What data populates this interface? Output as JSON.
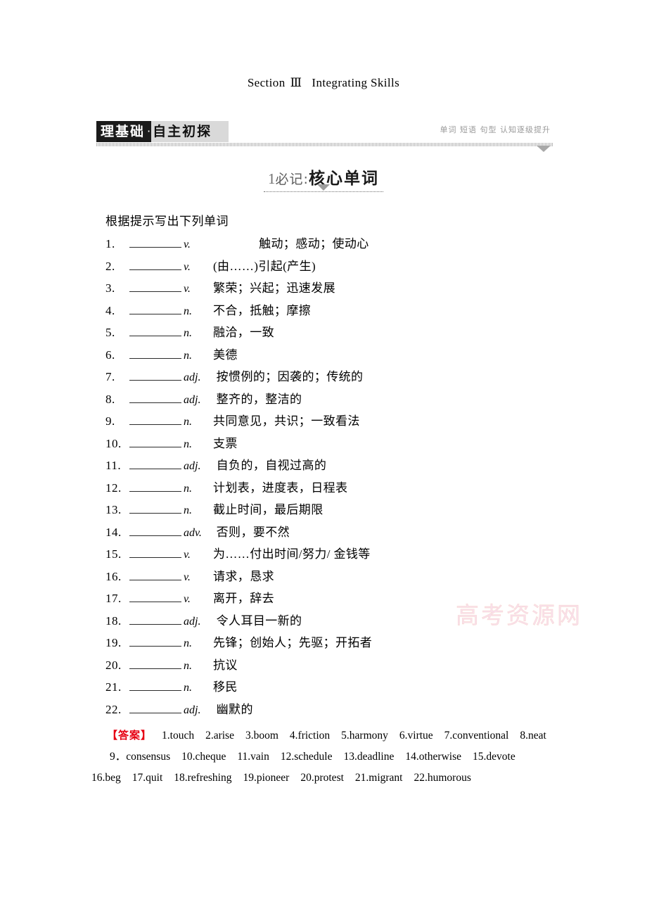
{
  "running_head": {
    "section_word": "Section",
    "section_number": "Ⅲ",
    "section_title": "Integrating Skills"
  },
  "banner": {
    "tag_dark": "理基础",
    "tag_dot": "·",
    "tag_light": "自主初探",
    "subtitle": "单词 短语 句型 认知逐级提升"
  },
  "part_heading": {
    "number": "1",
    "middle": "必记:",
    "main": "核心单词"
  },
  "instruction": "根据提示写出下列单词",
  "words": [
    {
      "num": "1.",
      "pos": "v.",
      "def": "              触动；感动；使动心"
    },
    {
      "num": "2.",
      "pos": "v.",
      "def": "(由……)引起(产生)"
    },
    {
      "num": "3.",
      "pos": "v.",
      "def": "繁荣；兴起；迅速发展"
    },
    {
      "num": "4.",
      "pos": "n.",
      "def": "不合，抵触；摩擦"
    },
    {
      "num": "5.",
      "pos": "n.",
      "def": "融洽，一致"
    },
    {
      "num": "6.",
      "pos": "n.",
      "def": "美德"
    },
    {
      "num": "7.",
      "pos": "adj.",
      "def": " 按惯例的；因袭的；传统的"
    },
    {
      "num": "8.",
      "pos": "adj.",
      "def": " 整齐的，整洁的"
    },
    {
      "num": "9.",
      "pos": "n.",
      "def": "共同意见，共识；一致看法"
    },
    {
      "num": "10.",
      "pos": "n.",
      "def": "支票"
    },
    {
      "num": "11.",
      "pos": "adj.",
      "def": " 自负的，自视过高的"
    },
    {
      "num": "12.",
      "pos": "n.",
      "def": "计划表，进度表，日程表"
    },
    {
      "num": "13.",
      "pos": "n.",
      "def": "截止时间，最后期限"
    },
    {
      "num": "14.",
      "pos": "adv.",
      "def": " 否则，要不然"
    },
    {
      "num": "15.",
      "pos": "v.",
      "def": "为……付出时间/努力/ 金钱等"
    },
    {
      "num": "16.",
      "pos": "v.",
      "def": "请求，恳求"
    },
    {
      "num": "17.",
      "pos": "v.",
      "def": "离开，辞去"
    },
    {
      "num": "18.",
      "pos": "adj.",
      "def": " 令人耳目一新的"
    },
    {
      "num": "19.",
      "pos": "n.",
      "def": "先锋；创始人；先驱；开拓者"
    },
    {
      "num": "20.",
      "pos": "n.",
      "def": "抗议"
    },
    {
      "num": "21.",
      "pos": "n.",
      "def": "移民"
    },
    {
      "num": "22.",
      "pos": "adj.",
      "def": " 幽默的"
    }
  ],
  "answers": {
    "label": "【答案】",
    "line1": [
      "1.touch",
      "2.arise",
      "3.boom",
      "4.friction",
      "5.harmony",
      "6.virtue",
      "7.conventional",
      "8.neat"
    ],
    "line2": [
      "9．consensus",
      "10.cheque",
      "11.vain",
      "12.schedule",
      "13.deadline",
      "14.otherwise",
      "15.devote"
    ],
    "line3": [
      "16.beg",
      "17.quit",
      "18.refreshing",
      "19.pioneer",
      "20.protest",
      "21.migrant",
      "22.humorous"
    ]
  },
  "watermark": {
    "text": "高考资源网"
  }
}
